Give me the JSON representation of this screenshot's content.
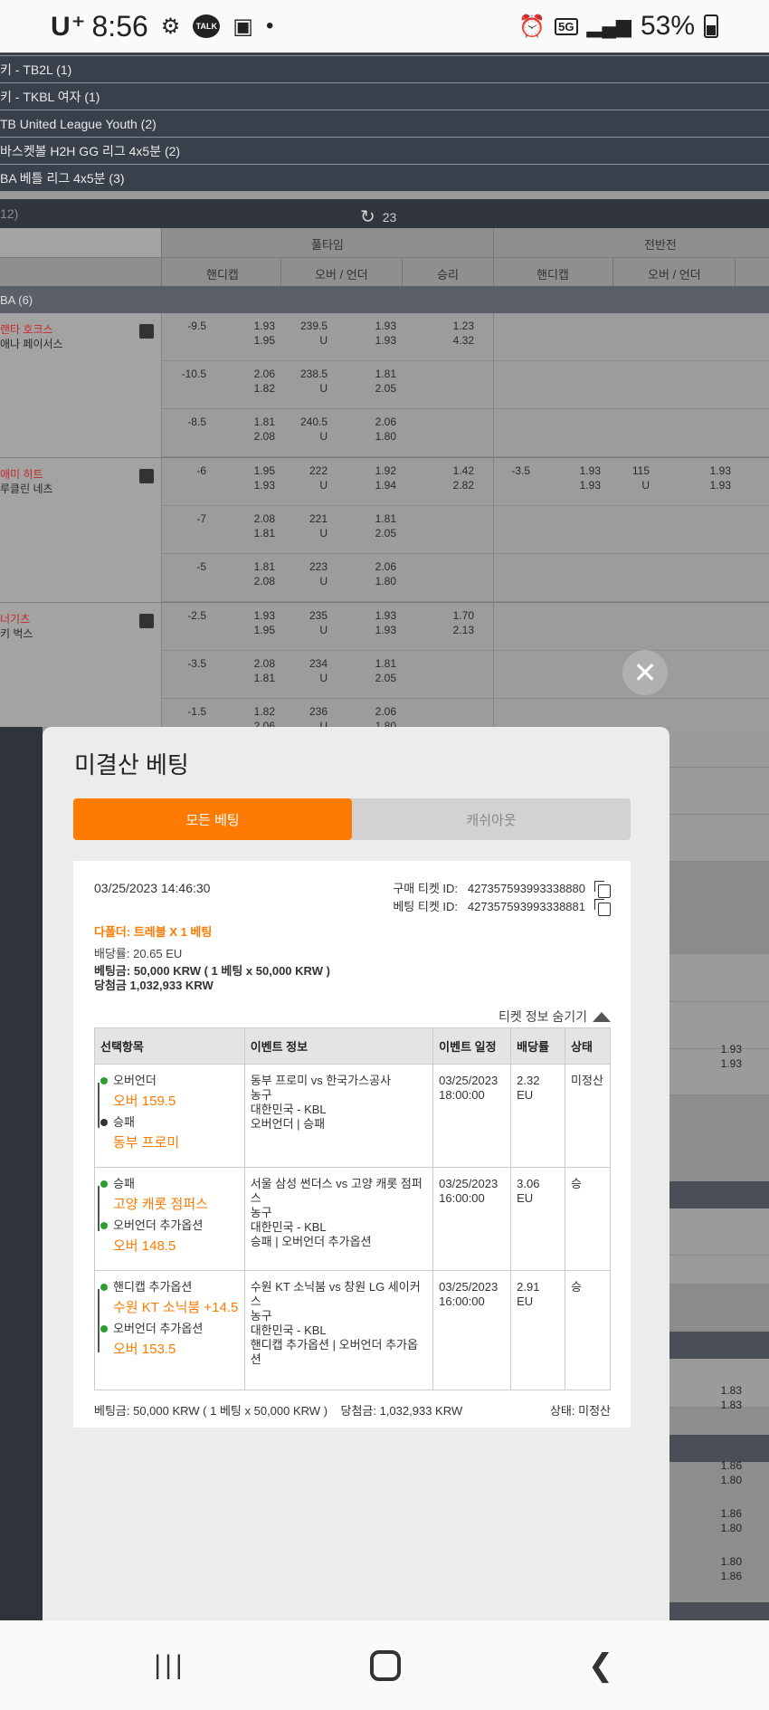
{
  "status_bar": {
    "carrier": "U⁺",
    "time": "8:56",
    "talk_label": "TALK",
    "network": "5G",
    "battery": "53%"
  },
  "leagues": [
    "키 - TB2L (1)",
    "키 - TKBL 여자 (1)",
    "TB United League Youth (2)",
    "바스켓볼 H2H GG 리그 4x5분 (2)",
    "BA 베틀 리그 4x5분 (3)"
  ],
  "refresh": {
    "left": "12)",
    "count": "23"
  },
  "board_headers": {
    "fulltime": "풀타임",
    "firsthalf": "전반전",
    "handicap": "핸디캡",
    "overunder": "오버 / 언더",
    "winloss": "승리"
  },
  "section": "BA (6)",
  "matches": [
    {
      "home": "랜타 호크스",
      "away": "애나 페이서스",
      "rows": [
        {
          "h": "-9.5",
          "h1": "1.93",
          "h2": "1.95",
          "ou": "239.5",
          "u": "U",
          "o1": "1.93",
          "o2": "1.93",
          "w1": "1.23",
          "w2": "4.32"
        },
        {
          "h": "-10.5",
          "h1": "2.06",
          "h2": "1.82",
          "ou": "238.5",
          "u": "U",
          "o1": "1.81",
          "o2": "2.05"
        },
        {
          "h": "-8.5",
          "h1": "1.81",
          "h2": "2.08",
          "ou": "240.5",
          "u": "U",
          "o1": "2.06",
          "o2": "1.80"
        }
      ]
    },
    {
      "home": "애미 히트",
      "away": "루클린 네츠",
      "rows": [
        {
          "h": "-6",
          "h1": "1.95",
          "h2": "1.93",
          "ou": "222",
          "u": "U",
          "o1": "1.92",
          "o2": "1.94",
          "w1": "1.42",
          "w2": "2.82",
          "fh": "-3.5",
          "fh1": "1.93",
          "fh2": "1.93",
          "fou": "115",
          "fu": "U",
          "fo1": "1.93",
          "fo2": "1.93"
        },
        {
          "h": "-7",
          "h1": "2.08",
          "h2": "1.81",
          "ou": "221",
          "u": "U",
          "o1": "1.81",
          "o2": "2.05"
        },
        {
          "h": "-5",
          "h1": "1.81",
          "h2": "2.08",
          "ou": "223",
          "u": "U",
          "o1": "2.06",
          "o2": "1.80"
        }
      ]
    },
    {
      "home": "너기츠",
      "away": "키 벅스",
      "rows": [
        {
          "h": "-2.5",
          "h1": "1.93",
          "h2": "1.95",
          "ou": "235",
          "u": "U",
          "o1": "1.93",
          "o2": "1.93",
          "w1": "1.70",
          "w2": "2.13"
        },
        {
          "h": "-3.5",
          "h1": "2.08",
          "h2": "1.81",
          "ou": "234",
          "u": "U",
          "o1": "1.81",
          "o2": "2.05"
        },
        {
          "h": "-1.5",
          "h1": "1.82",
          "h2": "2.06",
          "ou": "236",
          "u": "U",
          "o1": "2.06",
          "o2": "1.80"
        }
      ]
    }
  ],
  "right_odds": [
    {
      "a": "1.93",
      "b": "1.93"
    },
    {
      "a": "1.83",
      "b": "1.83"
    },
    {
      "a": "1.86",
      "b": "1.80"
    },
    {
      "a": "1.86",
      "b": "1.80"
    },
    {
      "a": "1.80",
      "b": "1.86"
    }
  ],
  "modal": {
    "title": "미결산 베팅",
    "tab_all": "모든 베팅",
    "tab_cashout": "캐쉬아웃",
    "ticket": {
      "date": "03/25/2023 14:46:30",
      "purchase_id_label": "구매 티켓 ID:",
      "purchase_id": "427357593993338880",
      "bet_id_label": "베팅 티켓 ID:",
      "bet_id": "427357593993338881",
      "bet_type": "다폴더: 트레블 X 1 베팅",
      "odds": "배당률: 20.65 EU",
      "stake": "베팅금: 50,000 KRW ( 1 베팅 x 50,000 KRW )",
      "payout": "당첨금 1,032,933 KRW",
      "hide_info": "티켓 정보 숨기기",
      "columns": [
        "선택항목",
        "이벤트 정보",
        "이벤트 일정",
        "배당률",
        "상태"
      ],
      "rows": [
        {
          "sel1_market": "오버언더",
          "sel1_pick": "오버 159.5",
          "sel2_market": "승패",
          "sel2_pick": "동부 프로미",
          "event": [
            "동부 프로미 vs 한국가스공사",
            "농구",
            "대한민국 - KBL",
            "오버언더 | 승패"
          ],
          "date": "03/25/2023",
          "time": "18:00:00",
          "odds": "2.32 EU",
          "status": "미정산"
        },
        {
          "sel1_market": "승패",
          "sel1_pick": "고양 캐롯 점퍼스",
          "sel2_market": "오버언더 추가옵션",
          "sel2_pick": "오버 148.5",
          "event": [
            "서울 삼성 썬더스 vs 고양 캐롯 점퍼스",
            "농구",
            "대한민국 - KBL",
            "승패 | 오버언더 추가옵션"
          ],
          "date": "03/25/2023",
          "time": "16:00:00",
          "odds": "3.06 EU",
          "status": "승"
        },
        {
          "sel1_market": "핸디캡 추가옵션",
          "sel1_pick": "수원 KT 소닉붐 +14.5",
          "sel2_market": "오버언더 추가옵션",
          "sel2_pick": "오버 153.5",
          "event": [
            "수원 KT 소닉붐 vs 창원 LG 세이커스",
            "농구",
            "대한민국 - KBL",
            "핸디캡 추가옵션 | 오버언더 추가옵션"
          ],
          "date": "03/25/2023",
          "time": "16:00:00",
          "odds": "2.91 EU",
          "status": "승"
        }
      ],
      "footer_stake": "베팅금: 50,000 KRW ( 1 베팅 x 50,000 KRW )",
      "footer_payout": "당첨금: 1,032,933 KRW",
      "footer_status": "상태: 미정산"
    }
  }
}
